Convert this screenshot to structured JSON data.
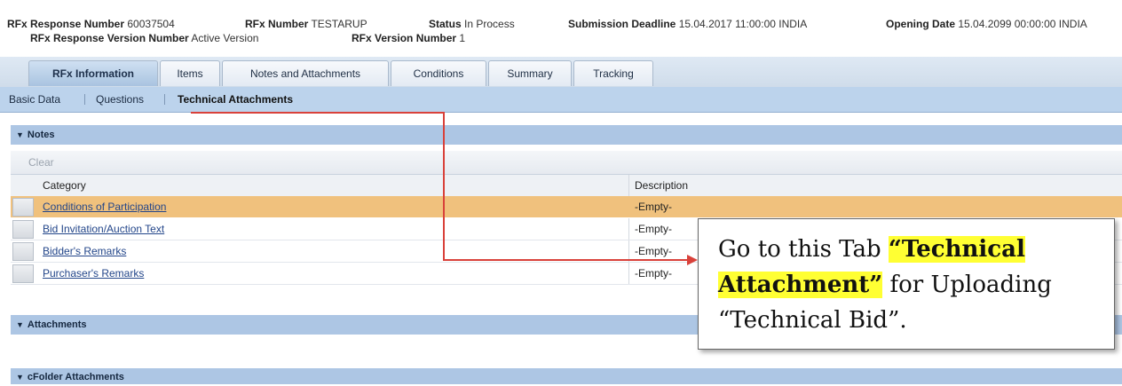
{
  "header": {
    "response_number_label": "RFx Response Number",
    "response_number_value": "60037504",
    "response_version_label": "RFx Response Version Number",
    "response_version_value": "Active Version",
    "rfx_number_label": "RFx Number",
    "rfx_number_value": "TESTARUP",
    "rfx_version_label": "RFx Version Number",
    "rfx_version_value": "1",
    "status_label": "Status",
    "status_value": "In Process",
    "deadline_label": "Submission Deadline",
    "deadline_value": "15.04.2017 11:00:00 INDIA",
    "opening_label": "Opening Date",
    "opening_value": "15.04.2099 00:00:00 INDIA"
  },
  "tabs": [
    {
      "label": "RFx Information"
    },
    {
      "label": "Items"
    },
    {
      "label": "Notes and Attachments"
    },
    {
      "label": "Conditions"
    },
    {
      "label": "Summary"
    },
    {
      "label": "Tracking"
    }
  ],
  "subnav": [
    {
      "label": "Basic Data"
    },
    {
      "label": "Questions"
    },
    {
      "label": "Technical Attachments"
    }
  ],
  "sections": {
    "notes": "Notes",
    "attachments": "Attachments",
    "cfolder": "cFolder Attachments"
  },
  "toolbar": {
    "clear_label": "Clear"
  },
  "table": {
    "columns": [
      "Category",
      "Description"
    ],
    "rows": [
      {
        "category": "Conditions of Participation",
        "description": "-Empty-"
      },
      {
        "category": "Bid Invitation/Auction Text",
        "description": "-Empty-"
      },
      {
        "category": "Bidder's Remarks",
        "description": "-Empty-"
      },
      {
        "category": "Purchaser's Remarks",
        "description": "-Empty-"
      }
    ]
  },
  "callout": {
    "line1_prefix": "Go to this Tab ",
    "line1_hl": "“Technical",
    "line2_hl": "Attachment”",
    "line2_suffix": " for Uploading",
    "line3": "“Technical Bid”."
  },
  "colors": {
    "highlight_row": "#f0c17d",
    "arrow": "#d9413a",
    "callout_highlight": "#ffff33",
    "section_bar": "#adc6e4"
  }
}
